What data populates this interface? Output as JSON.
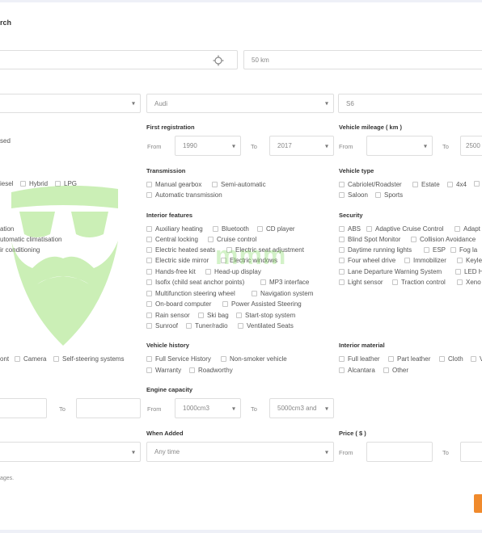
{
  "page": {
    "title_partial": "rch",
    "footnote_partial": "ages."
  },
  "location": {
    "radius_value": "50 km",
    "locate_icon": "crosshair-icon"
  },
  "make_model": {
    "make_value": "Audi",
    "model_value": "S6"
  },
  "first_registration": {
    "header": "First registration",
    "from_label": "From",
    "from_value": "1990",
    "to_label": "To",
    "to_value": "2017"
  },
  "mileage": {
    "header": "Vehicle mileage ( km )",
    "from_label": "From",
    "to_label": "To",
    "to_value_partial": "2500"
  },
  "condition_partial": "sed",
  "fuel_partial": [
    {
      "label": "iesel"
    },
    {
      "label": "Hybrid"
    },
    {
      "label": "LPG"
    }
  ],
  "transmission": {
    "header": "Transmission",
    "options": [
      {
        "label": "Manual gearbox"
      },
      {
        "label": "Semi-automatic"
      },
      {
        "label": "Automatic transmission"
      }
    ]
  },
  "vehicle_type": {
    "header": "Vehicle type",
    "options": [
      {
        "label": "Cabriolet/Roadster"
      },
      {
        "label": "Estate"
      },
      {
        "label": "4x4"
      },
      {
        "label": "Saloon"
      },
      {
        "label": "Sports"
      }
    ]
  },
  "climate_partial": [
    {
      "label": "ation"
    },
    {
      "label": "utomatic climatisation"
    },
    {
      "label": "ir conditioning"
    }
  ],
  "interior_features": {
    "header": "Interior features",
    "options": [
      {
        "label": "Auxiliary heating"
      },
      {
        "label": "Bluetooth"
      },
      {
        "label": "CD player"
      },
      {
        "label": "Central locking"
      },
      {
        "label": "Cruise control"
      },
      {
        "label": "Electric heated seats"
      },
      {
        "label": "Electric seat adjustment"
      },
      {
        "label": "Electric side mirror"
      },
      {
        "label": "Electric windows"
      },
      {
        "label": "Hands-free kit"
      },
      {
        "label": "Head-up display"
      },
      {
        "label": "Isofix (child seat anchor points)"
      },
      {
        "label": "MP3 interface"
      },
      {
        "label": "Multifunction steering wheel"
      },
      {
        "label": "Navigation system"
      },
      {
        "label": "On-board computer"
      },
      {
        "label": "Power Assisted Steering"
      },
      {
        "label": "Rain sensor"
      },
      {
        "label": "Ski bag"
      },
      {
        "label": "Start-stop system"
      },
      {
        "label": "Sunroof"
      },
      {
        "label": "Tuner/radio"
      },
      {
        "label": "Ventilated Seats"
      }
    ]
  },
  "security": {
    "header": "Security",
    "options": [
      {
        "label": "ABS"
      },
      {
        "label": "Adaptive Cruise Control"
      },
      {
        "label": "Adapt"
      },
      {
        "label": "Blind Spot Monitor"
      },
      {
        "label": "Collision Avoidance"
      },
      {
        "label": "Daytime running lights"
      },
      {
        "label": "ESP"
      },
      {
        "label": "Fog la"
      },
      {
        "label": "Four wheel drive"
      },
      {
        "label": "Immobilizer"
      },
      {
        "label": "Keyle"
      },
      {
        "label": "Lane Departure Warning System"
      },
      {
        "label": "LED H"
      },
      {
        "label": "Light sensor"
      },
      {
        "label": "Traction control"
      },
      {
        "label": "Xeno"
      }
    ]
  },
  "parking_partial": [
    {
      "label": "ont"
    },
    {
      "label": "Camera"
    },
    {
      "label": "Self-steering systems"
    }
  ],
  "vehicle_history": {
    "header": "Vehicle history",
    "options": [
      {
        "label": "Full Service History"
      },
      {
        "label": "Non-smoker vehicle"
      },
      {
        "label": "Warranty"
      },
      {
        "label": "Roadworthy"
      }
    ]
  },
  "interior_material": {
    "header": "Interior material",
    "options": [
      {
        "label": "Full leather"
      },
      {
        "label": "Part leather"
      },
      {
        "label": "Cloth"
      },
      {
        "label": "V"
      },
      {
        "label": "Alcantara"
      },
      {
        "label": "Other"
      }
    ]
  },
  "left_range": {
    "to_label": "To"
  },
  "engine_capacity": {
    "header": "Engine capacity",
    "from_label": "From",
    "from_value": "1000cm3",
    "to_label": "To",
    "to_value": "5000cm3 and"
  },
  "when_added": {
    "header": "When Added",
    "value": "Any time"
  },
  "price": {
    "header": "Price ( $ )",
    "from_label": "From",
    "to_label": "To"
  },
  "colors": {
    "accent": "#f08a2c",
    "watermark": "#8ddc60"
  }
}
